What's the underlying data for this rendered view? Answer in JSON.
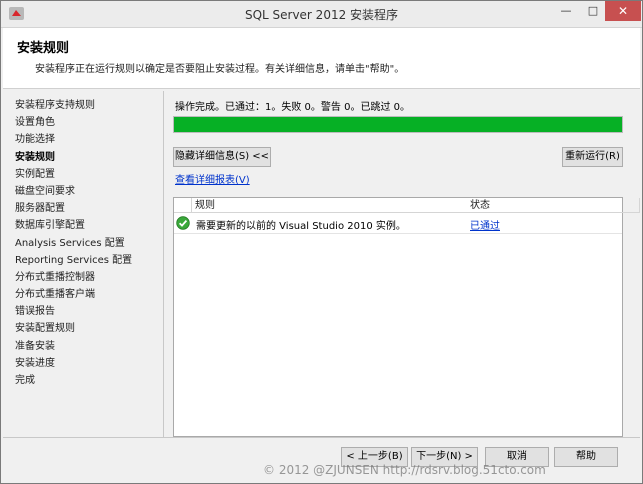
{
  "window": {
    "title": "SQL Server 2012 安装程序",
    "min_glyph": "—",
    "max_glyph": "□",
    "close_glyph": "✕"
  },
  "header": {
    "title": "安装规则",
    "description": "安装程序正在运行规则以确定是否要阻止安装过程。有关详细信息，请单击\"帮助\"。"
  },
  "steps": [
    {
      "label": "安装程序支持规则",
      "active": false
    },
    {
      "label": "设置角色",
      "active": false
    },
    {
      "label": "功能选择",
      "active": false
    },
    {
      "label": "安装规则",
      "active": true
    },
    {
      "label": "实例配置",
      "active": false
    },
    {
      "label": "磁盘空间要求",
      "active": false
    },
    {
      "label": "服务器配置",
      "active": false
    },
    {
      "label": "数据库引擎配置",
      "active": false
    },
    {
      "label": "Analysis Services 配置",
      "active": false
    },
    {
      "label": "Reporting Services 配置",
      "active": false
    },
    {
      "label": "分布式重播控制器",
      "active": false
    },
    {
      "label": "分布式重播客户端",
      "active": false
    },
    {
      "label": "错误报告",
      "active": false
    },
    {
      "label": "安装配置规则",
      "active": false
    },
    {
      "label": "准备安装",
      "active": false
    },
    {
      "label": "安装进度",
      "active": false
    },
    {
      "label": "完成",
      "active": false
    }
  ],
  "status": {
    "text": "操作完成。已通过：1。失败 0。警告 0。已跳过 0。",
    "progress_percent": 100,
    "progress_color": "#06b025"
  },
  "actions": {
    "hide_details": "隐藏详细信息(S) <<",
    "rerun": "重新运行(R)",
    "view_report": "查看详细报表(V)"
  },
  "table": {
    "columns": [
      "规则",
      "状态"
    ],
    "rows": [
      {
        "icon": "check-circle-icon",
        "rule": "需要更新的以前的 Visual Studio 2010 实例。",
        "status": "已通过"
      }
    ]
  },
  "footer": {
    "back": "< 上一步(B)",
    "next": "下一步(N) >",
    "cancel": "取消",
    "help": "帮助"
  },
  "watermark": "© 2012 @ZJUNSEN http://rdsrv.blog.51cto.com"
}
